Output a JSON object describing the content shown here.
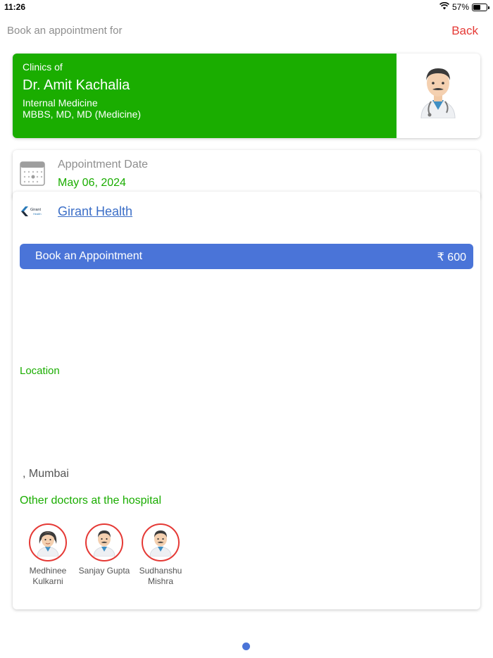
{
  "status": {
    "time": "11:26",
    "battery": "57%",
    "battery_level": 0.57
  },
  "nav": {
    "title": "Book an appointment for",
    "back_label": "Back"
  },
  "doctor": {
    "clinics_label": "Clinics of",
    "name": "Dr. Amit Kachalia",
    "specialty": "Internal Medicine",
    "degrees": "MBBS, MD, MD (Medicine)",
    "avatar_icon": "male-doctor-emoji",
    "card_color": "#1aad00"
  },
  "appointment": {
    "date_label": "Appointment Date",
    "date_value": "May 06, 2024",
    "icon": "calendar-icon"
  },
  "hospital": {
    "logo_text": "Girant",
    "logo_subtext": "Health",
    "name": "Girant Health",
    "book_label": "Book an Appointment",
    "price": "₹ 600",
    "location_label": "Location",
    "address": ",  Mumbai",
    "other_doctors_title": "Other doctors at the hospital",
    "other_doctors": [
      {
        "name": "Medhinee Kulkarni",
        "avatar_icon": "female-doctor-emoji"
      },
      {
        "name": "Sanjay Gupta",
        "avatar_icon": "male-doctor-emoji"
      },
      {
        "name": "Sudhanshu Mishra",
        "avatar_icon": "male-doctor-emoji"
      }
    ]
  },
  "colors": {
    "accent_green": "#1aad00",
    "button_blue": "#4a74d8",
    "back_red": "#e53935",
    "link_blue": "#3b6ec7"
  }
}
